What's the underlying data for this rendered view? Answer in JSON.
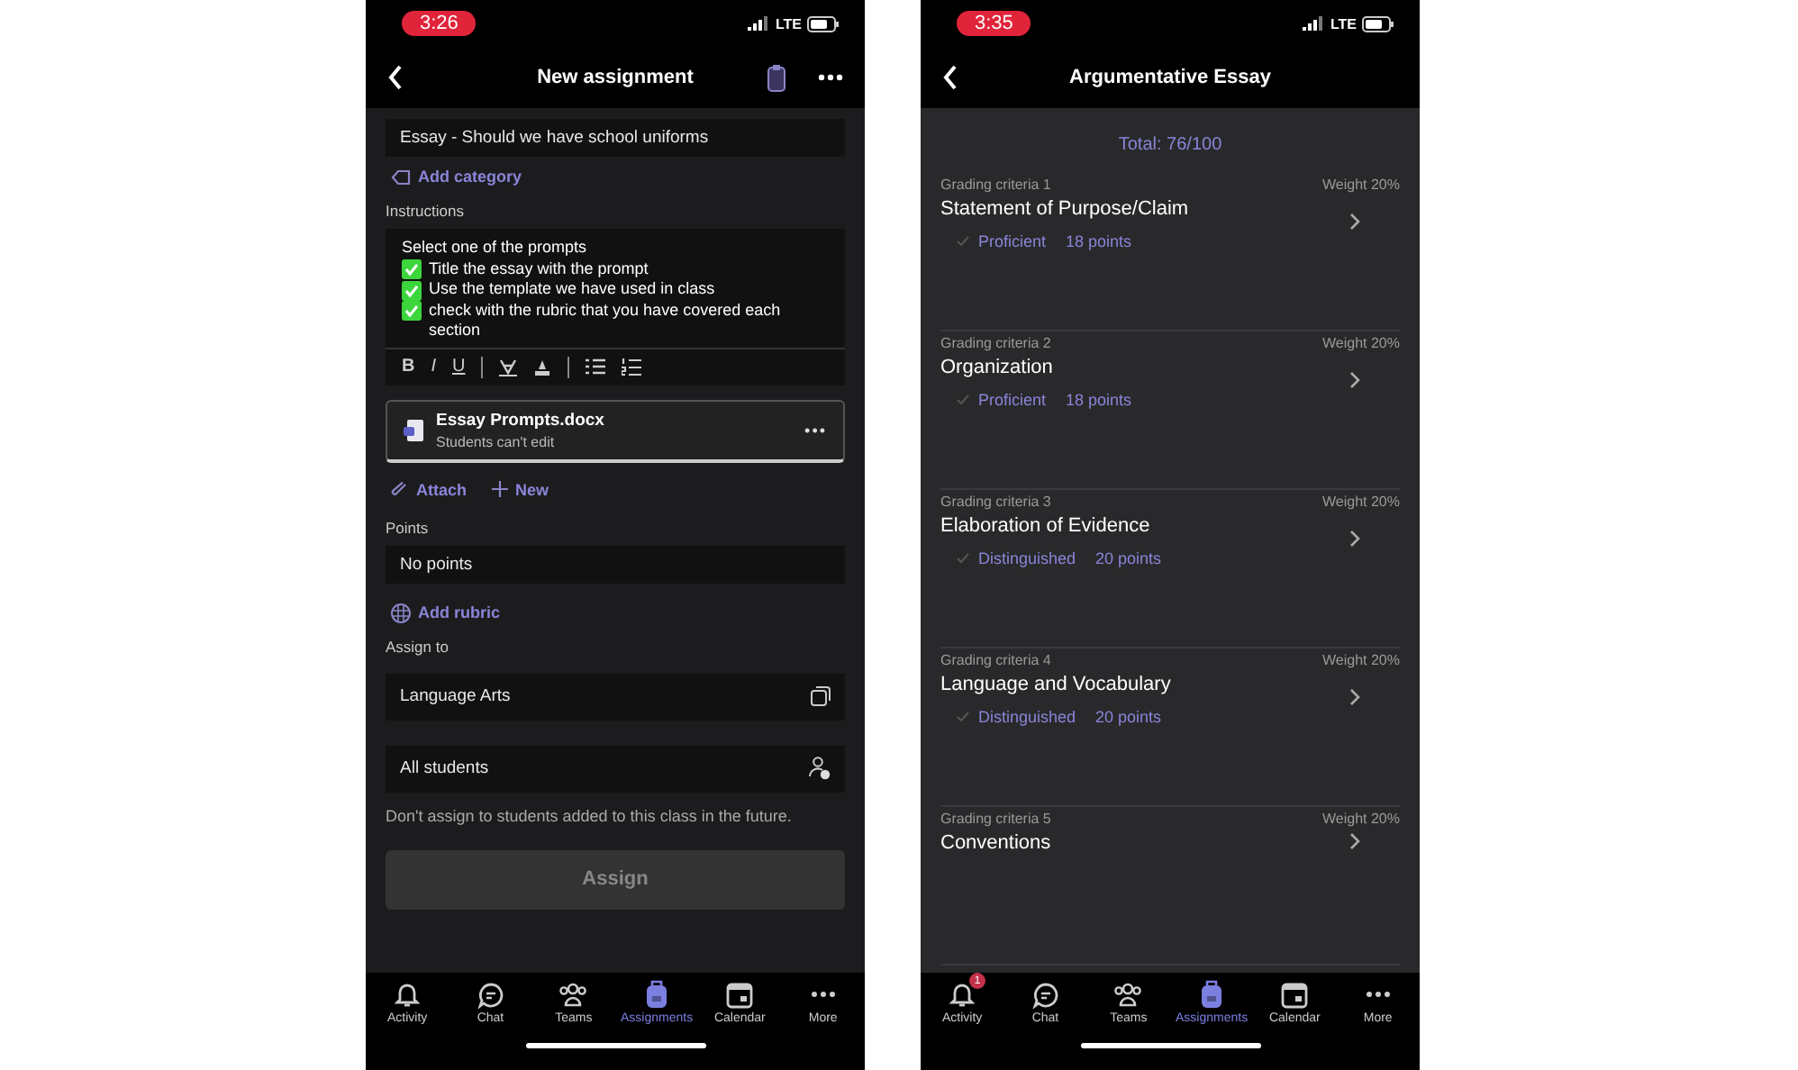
{
  "left_screen": {
    "status": {
      "time": "3:26",
      "network": "LTE"
    },
    "header": {
      "title": "New assignment"
    },
    "title_field": {
      "value": "Essay - Should we have school uniforms"
    },
    "add_category": "Add category",
    "instructions_label": "Instructions",
    "instructions": [
      {
        "kind": "text",
        "text": "Select one of the prompts"
      },
      {
        "kind": "check",
        "text": "Title the essay with the prompt"
      },
      {
        "kind": "check",
        "text": "Use the template we have used in class"
      },
      {
        "kind": "check",
        "text": "check with the rubric that you have covered each section"
      }
    ],
    "format_buttons": [
      "B",
      "I",
      "U"
    ],
    "attachment": {
      "name": "Essay Prompts.docx",
      "note": "Students can't edit",
      "menu": "•••"
    },
    "attach_actions": [
      "Attach",
      "New"
    ],
    "points_label": "Points",
    "points_field": {
      "value": "No points"
    },
    "add_rubric": "Add rubric",
    "assign_to_label": "Assign to",
    "class_field": {
      "value": "Language Arts"
    },
    "students_field": {
      "value": "All students"
    },
    "assign_note": "Don't assign to students added to this class in the future.",
    "assign_button": {
      "label": "Assign",
      "disabled": true
    },
    "tabs": [
      {
        "label": "Activity",
        "selected": false
      },
      {
        "label": "Chat",
        "selected": false
      },
      {
        "label": "Teams",
        "selected": false
      },
      {
        "label": "Assignments",
        "selected": true
      },
      {
        "label": "Calendar",
        "selected": false
      },
      {
        "label": "More",
        "selected": false
      }
    ]
  },
  "right_screen": {
    "status": {
      "time": "3:35",
      "network": "LTE"
    },
    "header": {
      "title": "Argumentative Essay"
    },
    "total": "Total: 76/100",
    "criteria": [
      {
        "label": "Grading criteria 1",
        "weight": "Weight 20%",
        "name": "Statement of Purpose/Claim",
        "level": "Proficient",
        "points": "18 points"
      },
      {
        "label": "Grading criteria 2",
        "weight": "Weight 20%",
        "name": "Organization",
        "level": "Proficient",
        "points": "18 points"
      },
      {
        "label": "Grading criteria 3",
        "weight": "Weight 20%",
        "name": "Elaboration of Evidence",
        "level": "Distinguished",
        "points": "20 points"
      },
      {
        "label": "Grading criteria 4",
        "weight": "Weight 20%",
        "name": "Language and Vocabulary",
        "level": "Distinguished",
        "points": "20 points"
      },
      {
        "label": "Grading criteria 5",
        "weight": "Weight 20%",
        "name": "Conventions"
      }
    ],
    "activity_badge": "1",
    "tabs": [
      {
        "label": "Activity",
        "selected": false
      },
      {
        "label": "Chat",
        "selected": false
      },
      {
        "label": "Teams",
        "selected": false
      },
      {
        "label": "Assignments",
        "selected": true
      },
      {
        "label": "Calendar",
        "selected": false
      },
      {
        "label": "More",
        "selected": false
      }
    ]
  }
}
